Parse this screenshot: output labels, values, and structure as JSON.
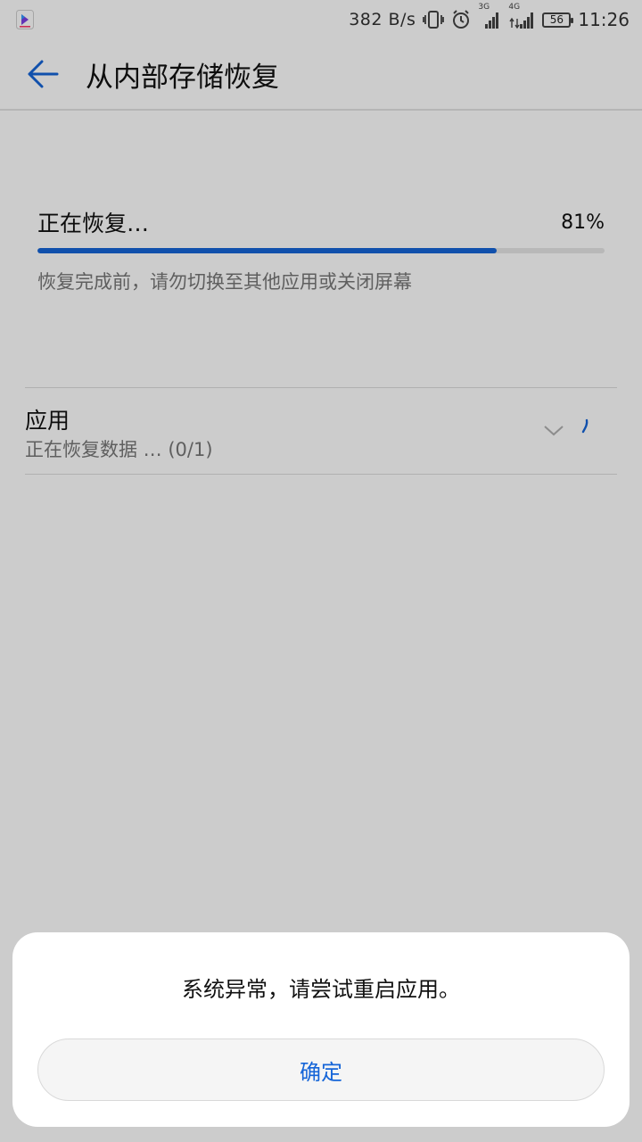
{
  "status_bar": {
    "net_speed": "382 B/s",
    "signal_1_label": "3G",
    "signal_2_label": "4G",
    "battery": "56",
    "time": "11:26"
  },
  "app_bar": {
    "title": "从内部存储恢复"
  },
  "progress": {
    "label": "正在恢复…",
    "percent_text": "81%",
    "value": 0.81,
    "hint": "恢复完成前，请勿切换至其他应用或关闭屏幕"
  },
  "app_item": {
    "title": "应用",
    "subtitle": "正在恢复数据 … (0/1)"
  },
  "dialog": {
    "message": "系统异常，请尝试重启应用。",
    "ok_label": "确定"
  },
  "colors": {
    "accent": "#1565d8",
    "track": "#e6e6e6",
    "secondary_text": "#777777"
  },
  "icons": {
    "app_notification": "video-app-icon",
    "vibrate": "vibrate-icon",
    "alarm": "alarm-icon",
    "signal": "signal-icon",
    "back": "back-arrow-icon",
    "expand": "chevron-down-icon",
    "loading": "loading-spinner-icon"
  }
}
